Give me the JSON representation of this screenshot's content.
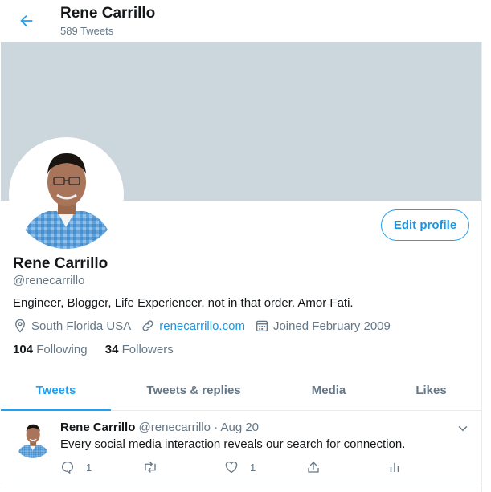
{
  "header": {
    "name": "Rene Carrillo",
    "tweet_count": "589 Tweets"
  },
  "profile": {
    "name": "Rene Carrillo",
    "handle": "@renecarrillo",
    "bio": "Engineer, Blogger, Life Experiencer, not in that order. Amor Fati.",
    "location": "South Florida USA",
    "website": "renecarrillo.com",
    "joined": "Joined February 2009",
    "following_count": "104",
    "following_label": "Following",
    "followers_count": "34",
    "followers_label": "Followers",
    "edit_label": "Edit profile"
  },
  "tabs": [
    {
      "label": "Tweets",
      "active": true
    },
    {
      "label": "Tweets & replies",
      "active": false
    },
    {
      "label": "Media",
      "active": false
    },
    {
      "label": "Likes",
      "active": false
    }
  ],
  "tweet": {
    "name": "Rene Carrillo",
    "handle": "@renecarrillo",
    "separator": "·",
    "date": "Aug 20",
    "text": "Every social media interaction reveals our search for connection.",
    "reply_count": "1",
    "retweet_count": "",
    "like_count": "1"
  },
  "colors": {
    "accent": "#1da1f2",
    "link": "#1b95e0",
    "banner": "#ccd6dd",
    "muted": "#657786"
  },
  "icons": [
    "back-arrow-icon",
    "location-pin-icon",
    "link-icon",
    "calendar-icon",
    "chevron-down-icon",
    "reply-icon",
    "retweet-icon",
    "like-icon",
    "share-icon",
    "analytics-icon"
  ]
}
